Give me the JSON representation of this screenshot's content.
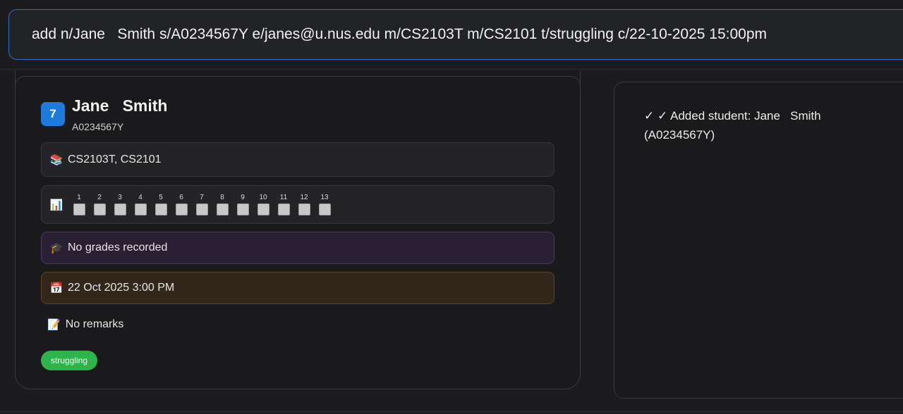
{
  "command": {
    "value": "add n/Jane   Smith s/A0234567Y e/janes@u.nus.edu m/CS2103T m/CS2101 t/struggling c/22-10-2025 15:00pm"
  },
  "student_card": {
    "index": "7",
    "name": "Jane   Smith",
    "student_id": "A0234567Y",
    "modules": "CS2103T, CS2101",
    "attendance_weeks": [
      "1",
      "2",
      "3",
      "4",
      "5",
      "6",
      "7",
      "8",
      "9",
      "10",
      "11",
      "12",
      "13"
    ],
    "grades": "No grades recorded",
    "consultation": "22 Oct 2025 3:00 PM",
    "remarks": "No remarks",
    "tags": [
      "struggling"
    ],
    "icons": {
      "modules": "books-icon",
      "attendance": "attendance-chart-icon",
      "grades": "graduation-cap-icon",
      "consultation": "calendar-icon",
      "remarks": "memo-icon"
    }
  },
  "result": {
    "message": "✓ ✓ Added student: Jane   Smith\n(A0234567Y)"
  },
  "colors": {
    "accent": "#1f7ae0",
    "tag": "#2eb34d",
    "grades_bg": "#2a2034",
    "consult_bg": "#33261a"
  }
}
